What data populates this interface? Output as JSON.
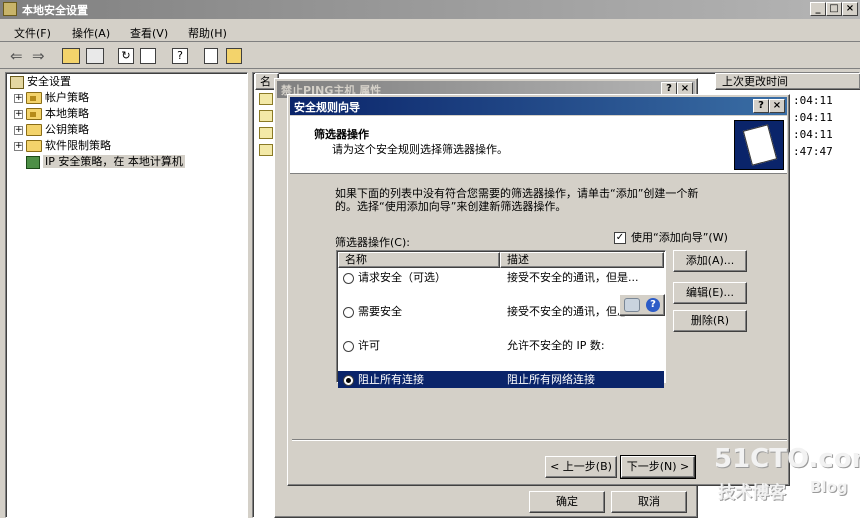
{
  "app": {
    "title": "本地安全设置",
    "menu": [
      "文件(F)",
      "操作(A)",
      "查看(V)",
      "帮助(H)"
    ],
    "window_buttons": [
      "_",
      "□",
      "×"
    ]
  },
  "tree": {
    "root": "安全设置",
    "items": [
      {
        "label": "帐户策略"
      },
      {
        "label": "本地策略"
      },
      {
        "label": "公钥策略"
      },
      {
        "label": "软件限制策略"
      },
      {
        "label": "IP 安全策略，在 本地计算机"
      }
    ]
  },
  "right_list": {
    "header_name": "名",
    "header_last_modified": "上次更改时间",
    "times": [
      ":04:11",
      ":04:11",
      ":04:11",
      ":47:47"
    ]
  },
  "bg_dialog": {
    "title": "禁止PING主机 属性",
    "ok": "确定",
    "cancel": "取消",
    "help_btn": "?",
    "close_btn": "×"
  },
  "wizard": {
    "title": "安全规则向导",
    "help_btn": "?",
    "close_btn": "×",
    "heading": "筛选器操作",
    "subheading": "请为这个安全规则选择筛选器操作。",
    "instruction_line1": "如果下面的列表中没有符合您需要的筛选器操作，请单击“添加”创建一个新",
    "instruction_line2": "的。选择“使用添加向导”来创建新筛选器操作。",
    "list_label": "筛选器操作(C):",
    "use_wizard_label": "使用“添加向导”(W)",
    "use_wizard_checked": "✓",
    "columns": {
      "name": "名称",
      "desc": "描述"
    },
    "rows": [
      {
        "name": "请求安全（可选）",
        "desc": "接受不安全的通讯，但是...",
        "selected": false
      },
      {
        "name": "需要安全",
        "desc": "接受不安全的通讯，但总",
        "selected": false
      },
      {
        "name": "许可",
        "desc": "允许不安全的 IP 数:",
        "selected": false
      },
      {
        "name": "阻止所有连接",
        "desc": "阻止所有网络连接",
        "selected": true
      }
    ],
    "buttons": {
      "add": "添加(A)...",
      "edit": "编辑(E)...",
      "remove": "删除(R)",
      "back": "< 上一步(B)",
      "next": "下一步(N) >"
    }
  },
  "watermark": {
    "brand": "51CTO.com",
    "sub": "技术博客",
    "blog": "Blog"
  }
}
